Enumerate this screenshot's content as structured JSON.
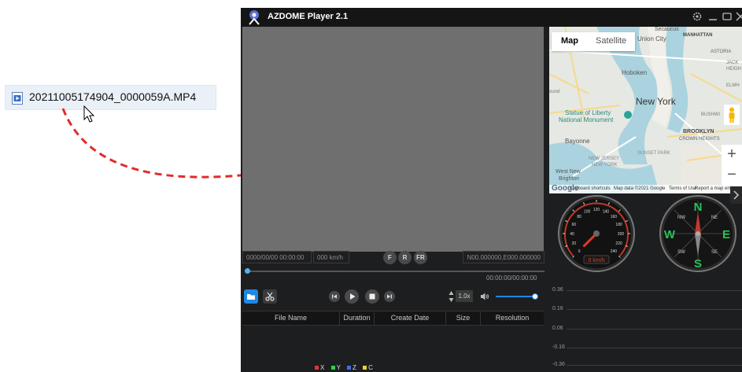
{
  "file": {
    "name": "20211005174904_0000059A.MP4",
    "icon": "video-file-icon"
  },
  "app": {
    "title": "AZDOME Player 2.1",
    "logo": "azdome-logo-icon"
  },
  "window_controls": [
    "settings-icon",
    "minimize-icon",
    "maximize-icon",
    "close-icon"
  ],
  "info_bar": {
    "datetime": "0000/00/00 00:00:00",
    "speed": "000 km/h",
    "cam_front": "F",
    "cam_rear": "R",
    "cam_both": "FR",
    "coordinates": "N00.000000,E000.000000"
  },
  "playback": {
    "time": "00:00:00/00:00:00",
    "progress": 0,
    "rate": "1.0x",
    "volume": 1.0
  },
  "table": {
    "columns": [
      "File Name",
      "Duration",
      "Create Date",
      "Size",
      "Resolution"
    ]
  },
  "map": {
    "tabs": [
      "Map",
      "Satellite"
    ],
    "zoom_in": "+",
    "zoom_out": "−",
    "labels": [
      "Secaucus",
      "Union City",
      "MANHATTAN",
      "ASTORIA",
      "Hoboken",
      "New York",
      "Statue of Liberty",
      "National Monument",
      "Bayonne",
      "BROOKLYN",
      "CROWN HEIGHTS",
      "SUNSET PARK",
      "NEW JERSEY",
      "NEW YORK",
      "West New",
      "Brighton",
      "BUSHWI",
      "JACK",
      "HEIGH",
      "ELMH",
      "ound"
    ],
    "google": "Google",
    "attribution": [
      "Keyboard shortcuts",
      "Map data ©2021 Google",
      "Terms of Use",
      "Report a map error"
    ]
  },
  "speedometer": {
    "readout": "0 km/h",
    "speed": 0,
    "ticks": [
      "0",
      "20",
      "40",
      "60",
      "80",
      "100",
      "120",
      "140",
      "160",
      "180",
      "200",
      "220",
      "240"
    ]
  },
  "compass": {
    "labels": [
      "N",
      "E",
      "S",
      "W",
      "NE",
      "SE",
      "SW",
      "NW"
    ]
  },
  "gsensor": {
    "yticks": [
      "0.36",
      "0.16",
      "0.06",
      "-0.16",
      "-0.36"
    ],
    "legend": [
      "X",
      "Y",
      "Z",
      "C"
    ],
    "colors": {
      "X": "#e8332f",
      "Y": "#2fd14a",
      "Z": "#3a6fe8",
      "C": "#e8d62f"
    }
  },
  "colors": {
    "accent": "#1e88e5",
    "drag_arrow": "#e32b2b",
    "video_bg": "#6f6f6f",
    "panel_bg": "#1d1e20"
  }
}
